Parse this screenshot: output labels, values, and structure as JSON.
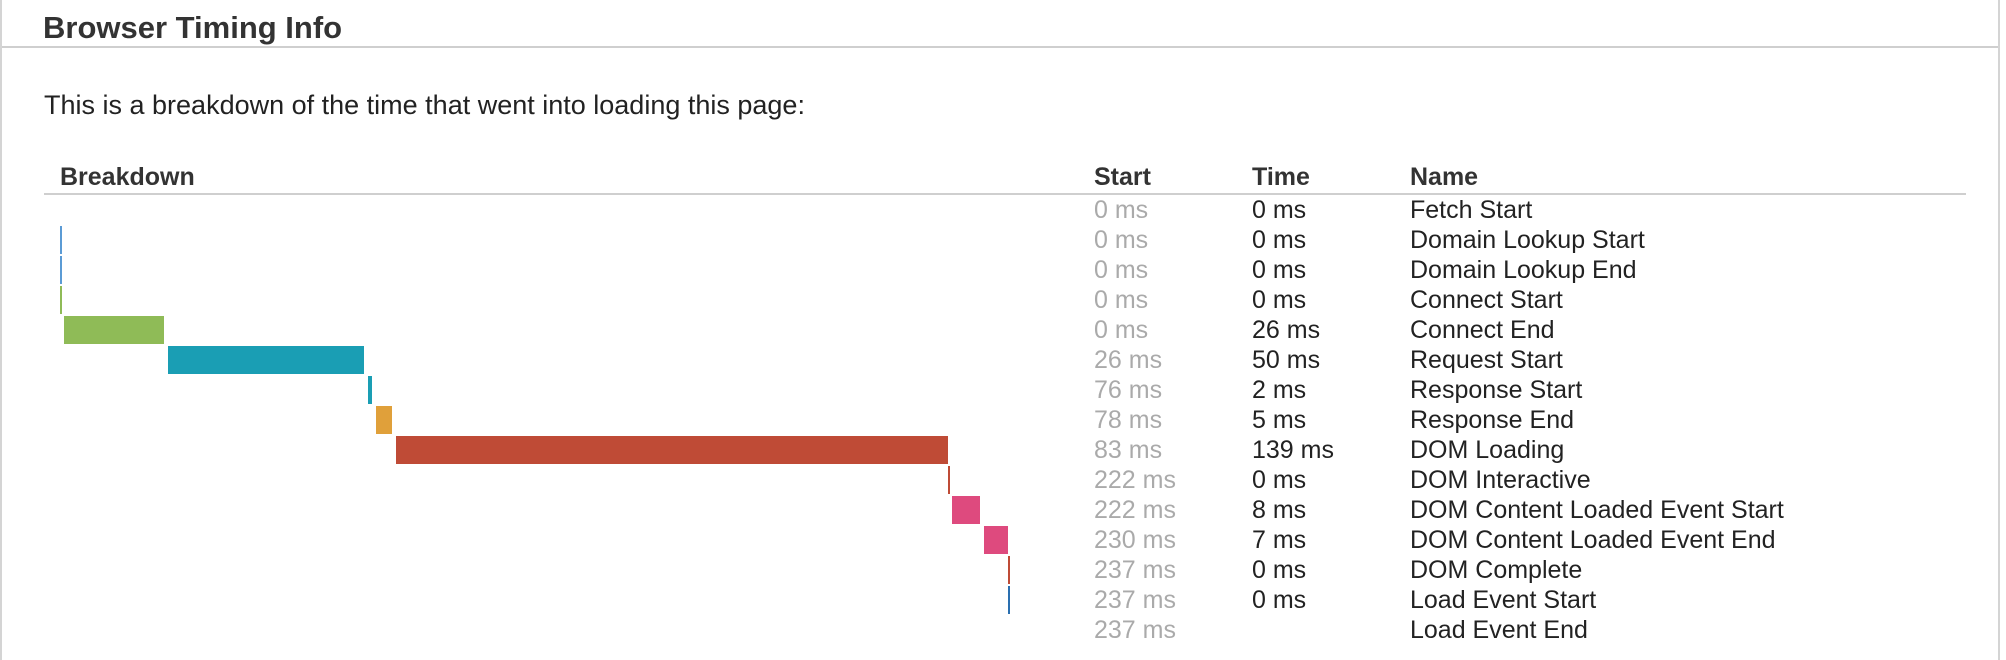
{
  "header": {
    "title": "Browser Timing Info"
  },
  "intro": "This is a breakdown of the time that went into loading this page:",
  "table": {
    "headers": {
      "breakdown": "Breakdown",
      "start": "Start",
      "time": "Time",
      "name": "Name"
    },
    "rows": [
      {
        "start": "0 ms",
        "time": "0 ms",
        "name": "Fetch Start",
        "bar_start_ms": 0,
        "bar_duration_ms": 0,
        "bar_color": null
      },
      {
        "start": "0 ms",
        "time": "0 ms",
        "name": "Domain Lookup Start",
        "bar_start_ms": 0,
        "bar_duration_ms": 0,
        "bar_color": "#5b9bd5"
      },
      {
        "start": "0 ms",
        "time": "0 ms",
        "name": "Domain Lookup End",
        "bar_start_ms": 0,
        "bar_duration_ms": 0,
        "bar_color": "#5b9bd5"
      },
      {
        "start": "0 ms",
        "time": "0 ms",
        "name": "Connect Start",
        "bar_start_ms": 0,
        "bar_duration_ms": 0,
        "bar_color": "#8fbb57"
      },
      {
        "start": "0 ms",
        "time": "26 ms",
        "name": "Connect End",
        "bar_start_ms": 0,
        "bar_duration_ms": 26,
        "bar_color": "#8fbb57"
      },
      {
        "start": "26 ms",
        "time": "50 ms",
        "name": "Request Start",
        "bar_start_ms": 26,
        "bar_duration_ms": 50,
        "bar_color": "#1a9eb4"
      },
      {
        "start": "76 ms",
        "time": "2 ms",
        "name": "Response Start",
        "bar_start_ms": 76,
        "bar_duration_ms": 2,
        "bar_color": "#1a9eb4"
      },
      {
        "start": "78 ms",
        "time": "5 ms",
        "name": "Response End",
        "bar_start_ms": 78,
        "bar_duration_ms": 5,
        "bar_color": "#e0a03a"
      },
      {
        "start": "83 ms",
        "time": "139 ms",
        "name": "DOM Loading",
        "bar_start_ms": 83,
        "bar_duration_ms": 139,
        "bar_color": "#bf4b36"
      },
      {
        "start": "222 ms",
        "time": "0 ms",
        "name": "DOM Interactive",
        "bar_start_ms": 222,
        "bar_duration_ms": 0,
        "bar_color": "#bf4b36"
      },
      {
        "start": "222 ms",
        "time": "8 ms",
        "name": "DOM Content Loaded Event Start",
        "bar_start_ms": 222,
        "bar_duration_ms": 8,
        "bar_color": "#de4a7e"
      },
      {
        "start": "230 ms",
        "time": "7 ms",
        "name": "DOM Content Loaded Event End",
        "bar_start_ms": 230,
        "bar_duration_ms": 7,
        "bar_color": "#de4a7e"
      },
      {
        "start": "237 ms",
        "time": "0 ms",
        "name": "DOM Complete",
        "bar_start_ms": 237,
        "bar_duration_ms": 0,
        "bar_color": "#bf4b36"
      },
      {
        "start": "237 ms",
        "time": "0 ms",
        "name": "Load Event Start",
        "bar_start_ms": 237,
        "bar_duration_ms": 0,
        "bar_color": "#2a6fb0"
      },
      {
        "start": "237 ms",
        "time": "",
        "name": "Load Event End",
        "bar_start_ms": 237,
        "bar_duration_ms": 0,
        "bar_color": null
      }
    ]
  }
}
